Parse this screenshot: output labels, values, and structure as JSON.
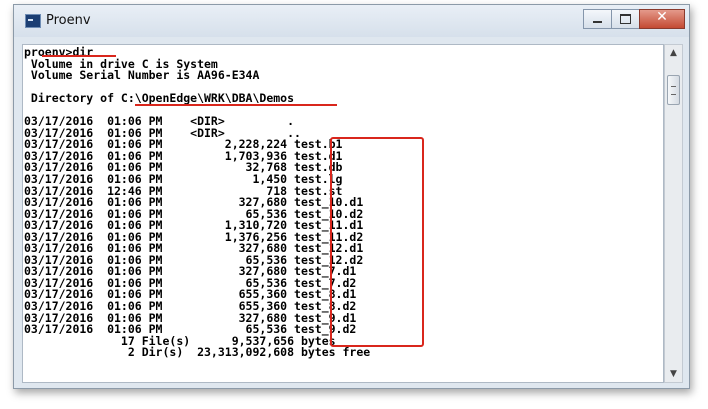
{
  "window": {
    "title": "Proenv",
    "icon": "console-icon",
    "controls": {
      "minimize": "minimize-icon",
      "maximize": "maximize-icon",
      "close": "close-icon",
      "close_glyph": "✕"
    }
  },
  "console": {
    "prompt": "proenv>dir",
    "volume_label": " Volume in drive C is System",
    "volume_serial": " Volume Serial Number is AA96-E34A",
    "directory": " Directory of C:\\OpenEdge\\WRK\\DBA\\Demos",
    "entries": [
      {
        "date": "03/17/2016",
        "time": "01:06 PM",
        "size": "<DIR>",
        "name": "."
      },
      {
        "date": "03/17/2016",
        "time": "01:06 PM",
        "size": "<DIR>",
        "name": ".."
      },
      {
        "date": "03/17/2016",
        "time": "01:06 PM",
        "size": "2,228,224",
        "name": "test.b1"
      },
      {
        "date": "03/17/2016",
        "time": "01:06 PM",
        "size": "1,703,936",
        "name": "test.d1"
      },
      {
        "date": "03/17/2016",
        "time": "01:06 PM",
        "size": "32,768",
        "name": "test.db"
      },
      {
        "date": "03/17/2016",
        "time": "01:06 PM",
        "size": "1,450",
        "name": "test.lg"
      },
      {
        "date": "03/17/2016",
        "time": "12:46 PM",
        "size": "718",
        "name": "test.st"
      },
      {
        "date": "03/17/2016",
        "time": "01:06 PM",
        "size": "327,680",
        "name": "test_10.d1"
      },
      {
        "date": "03/17/2016",
        "time": "01:06 PM",
        "size": "65,536",
        "name": "test_10.d2"
      },
      {
        "date": "03/17/2016",
        "time": "01:06 PM",
        "size": "1,310,720",
        "name": "test_11.d1"
      },
      {
        "date": "03/17/2016",
        "time": "01:06 PM",
        "size": "1,376,256",
        "name": "test_11.d2"
      },
      {
        "date": "03/17/2016",
        "time": "01:06 PM",
        "size": "327,680",
        "name": "test_12.d1"
      },
      {
        "date": "03/17/2016",
        "time": "01:06 PM",
        "size": "65,536",
        "name": "test_12.d2"
      },
      {
        "date": "03/17/2016",
        "time": "01:06 PM",
        "size": "327,680",
        "name": "test_7.d1"
      },
      {
        "date": "03/17/2016",
        "time": "01:06 PM",
        "size": "65,536",
        "name": "test_7.d2"
      },
      {
        "date": "03/17/2016",
        "time": "01:06 PM",
        "size": "655,360",
        "name": "test_8.d1"
      },
      {
        "date": "03/17/2016",
        "time": "01:06 PM",
        "size": "655,360",
        "name": "test_8.d2"
      },
      {
        "date": "03/17/2016",
        "time": "01:06 PM",
        "size": "327,680",
        "name": "test_9.d1"
      },
      {
        "date": "03/17/2016",
        "time": "01:06 PM",
        "size": "65,536",
        "name": "test_9.d2"
      }
    ],
    "summary_files": "              17 File(s)      9,537,656 bytes",
    "summary_dirs": "               2 Dir(s)  23,313,092,608 bytes free"
  },
  "scrollbar": {
    "up_arrow": "▲",
    "down_arrow": "▼"
  },
  "annotation_color": "#d9261c"
}
